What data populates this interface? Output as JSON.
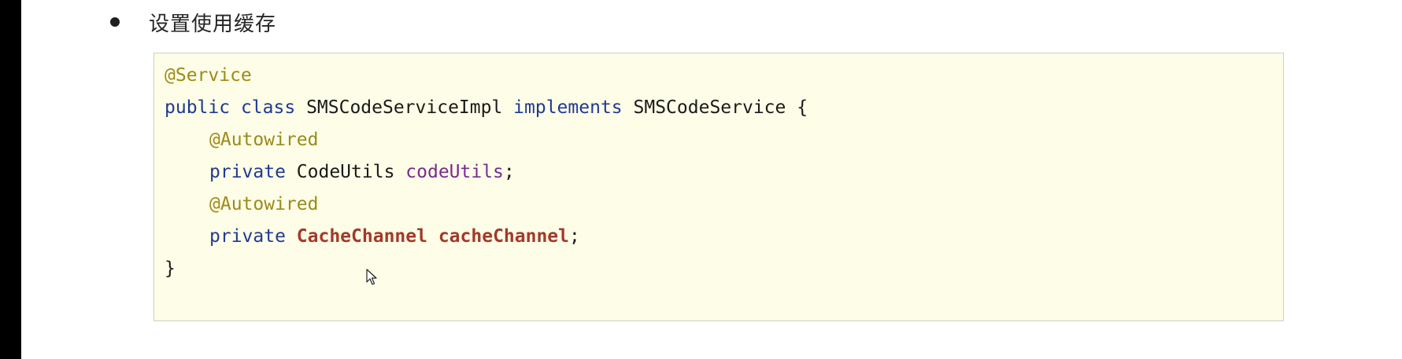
{
  "bullet": {
    "text": "设置使用缓存"
  },
  "code": {
    "line1": {
      "annotation": "@Service"
    },
    "line2": {
      "kw_public": "public",
      "kw_class": "class",
      "class_name": "SMSCodeServiceImpl",
      "kw_implements": "implements",
      "interface_name": "SMSCodeService",
      "brace_open": "{"
    },
    "line3": {
      "annotation": "@Autowired"
    },
    "line4": {
      "kw_private": "private",
      "type": "CodeUtils",
      "field": "codeUtils",
      "semicolon": ";"
    },
    "line5": {
      "annotation": "@Autowired"
    },
    "line6": {
      "kw_private": "private",
      "type": "CacheChannel",
      "field": "cacheChannel",
      "semicolon": ";"
    },
    "line7": {
      "brace_close": "}"
    }
  },
  "colors": {
    "annotation": "#9c8a1a",
    "keyword": "#1f3a93",
    "field": "#7a2b8e",
    "highlight": "#a23a2a",
    "code_background": "#fefde7"
  },
  "icons": {
    "cursor": "mouse-pointer-icon"
  }
}
